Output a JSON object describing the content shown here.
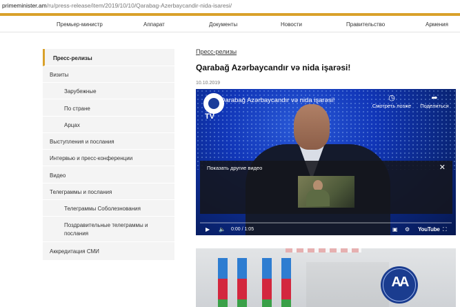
{
  "browser": {
    "url_domain": "primeminister.am",
    "url_path": "/ru/press-release/item/2019/10/10/Qarabag-Azerbaycandir-nida-isaresi/"
  },
  "topnav": {
    "items": [
      "Премьер-министр",
      "Аппарат",
      "Документы",
      "Новости",
      "Правительство",
      "Армения"
    ]
  },
  "sidebar": {
    "items": [
      {
        "label": "Пресс-релизы",
        "active": true
      },
      {
        "label": "Визиты"
      },
      {
        "label": "Зарубежные"
      },
      {
        "label": "По стране"
      },
      {
        "label": "Арцах"
      },
      {
        "label": "Выступления и послания"
      },
      {
        "label": "Интервью и пресс-конференции"
      },
      {
        "label": "Видео"
      },
      {
        "label": "Телеграммы и послания"
      },
      {
        "label": "Телеграммы Соболезнования"
      },
      {
        "label": "Поздравительные телеграммы и послания"
      },
      {
        "label": "Аккредитация СМИ"
      }
    ]
  },
  "article": {
    "breadcrumb": "Пресс-релизы",
    "title": "Qarabağ Azərbaycandır və nida işarəsi!",
    "date": "10.10.2019"
  },
  "video": {
    "title": "Qarabağ Azərbaycandır və nida işarəsi!",
    "channel_logo_text": "TV",
    "watch_later": "Смотреть позже",
    "share": "Поделиться",
    "more_videos": "Показать другие видео",
    "time": "0:00 / 1:05",
    "brand": "YouTube",
    "progress": 0
  },
  "colors": {
    "accent": "#d9a12a"
  }
}
